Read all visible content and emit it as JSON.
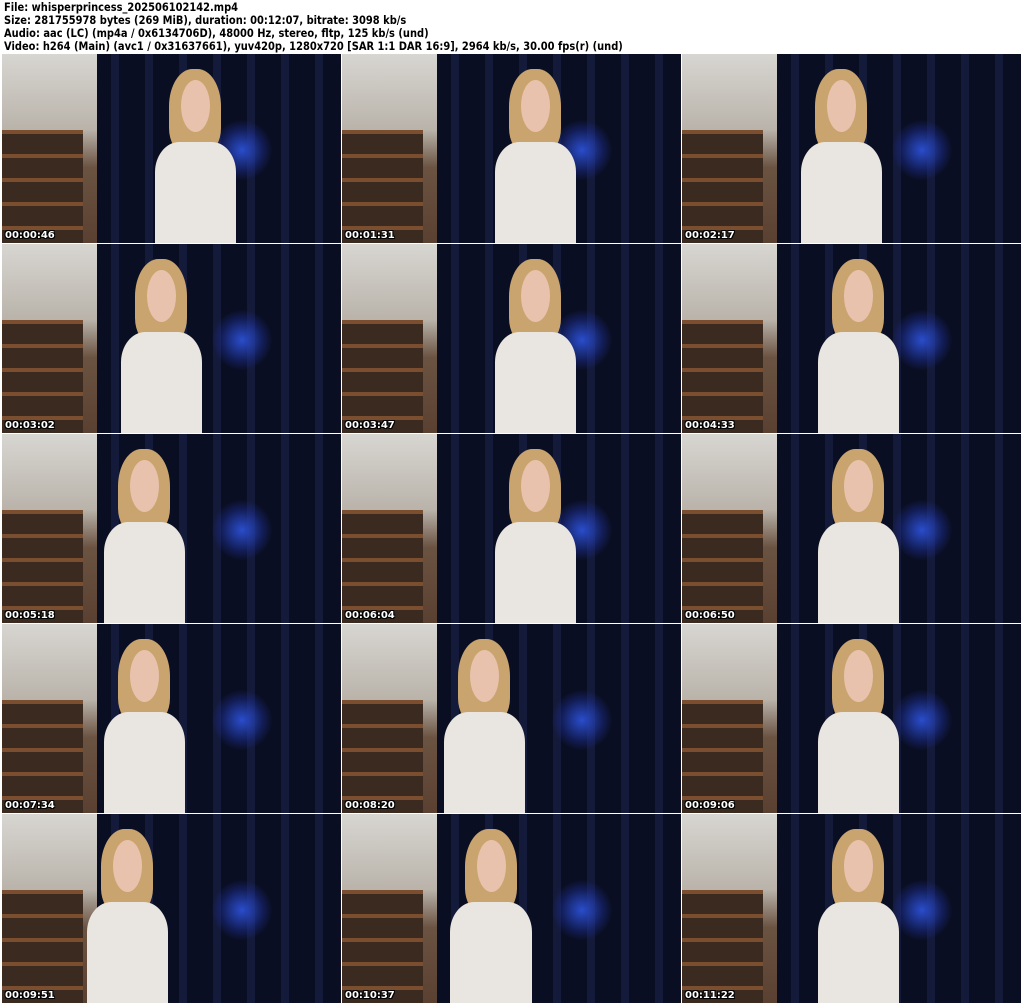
{
  "header": {
    "file": "File: whisperprincess_202506102142.mp4",
    "size": "Size: 281755978 bytes (269 MiB), duration: 00:12:07, bitrate: 3098 kb/s",
    "audio": "Audio: aac (LC) (mp4a / 0x6134706D), 48000 Hz, stereo, fltp, 125 kb/s (und)",
    "video": "Video: h264 (Main) (avc1 / 0x31637661), yuv420p, 1280x720 [SAR 1:1 DAR 16:9], 2964 kb/s, 30.00 fps(r) (und)"
  },
  "thumbnails": [
    {
      "timestamp": "00:00:46"
    },
    {
      "timestamp": "00:01:31"
    },
    {
      "timestamp": "00:02:17"
    },
    {
      "timestamp": "00:03:02"
    },
    {
      "timestamp": "00:03:47"
    },
    {
      "timestamp": "00:04:33"
    },
    {
      "timestamp": "00:05:18"
    },
    {
      "timestamp": "00:06:04"
    },
    {
      "timestamp": "00:06:50"
    },
    {
      "timestamp": "00:07:34"
    },
    {
      "timestamp": "00:08:20"
    },
    {
      "timestamp": "00:09:06"
    },
    {
      "timestamp": "00:09:51"
    },
    {
      "timestamp": "00:10:37"
    },
    {
      "timestamp": "00:11:22"
    }
  ]
}
